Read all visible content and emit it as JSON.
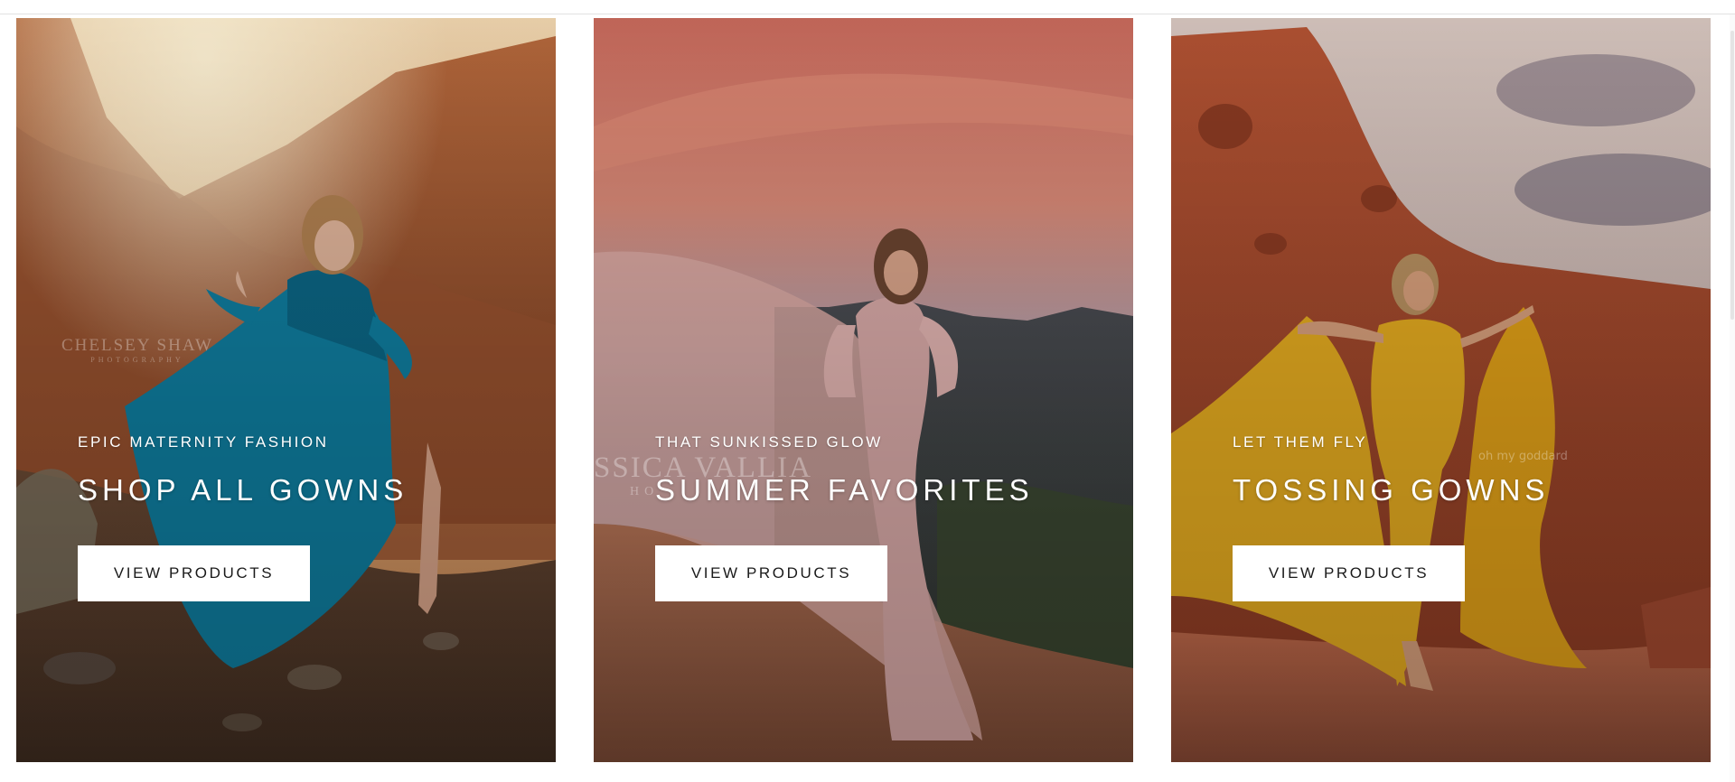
{
  "cards": [
    {
      "eyebrow": "EPIC MATERNITY FASHION",
      "title": "SHOP ALL GOWNS",
      "button_label": "VIEW PRODUCTS",
      "watermark": "CHELSEY SHAW",
      "watermark_sub": "PHOTOGRAPHY",
      "dress_color": "#0f7ea0"
    },
    {
      "eyebrow": "THAT SUNKISSED GLOW",
      "title": "SUMMER FAVORITES",
      "button_label": "VIEW PRODUCTS",
      "watermark": "SSICA VALLIA",
      "watermark_sub": "HO",
      "dress_color": "#d9aaa8"
    },
    {
      "eyebrow": "LET THEM FLY",
      "title": "TOSSING GOWNS",
      "button_label": "VIEW PRODUCTS",
      "watermark": "oh my goddard",
      "watermark_sub": "",
      "dress_color": "#e6ac20"
    }
  ]
}
